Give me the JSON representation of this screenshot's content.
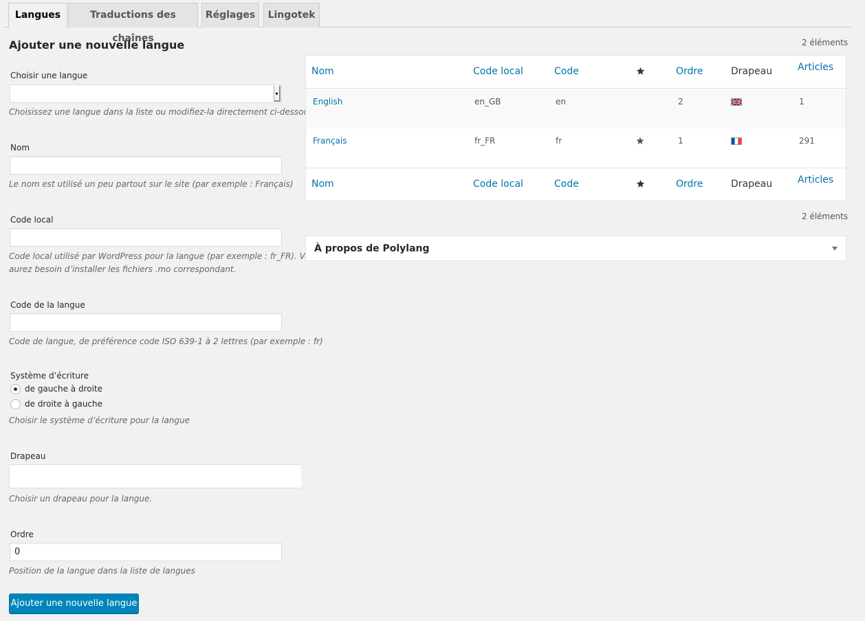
{
  "tabs": [
    "Langues",
    "Traductions des chaînes",
    "Réglages",
    "Lingotek"
  ],
  "form": {
    "title": "Ajouter une nouvelle langue",
    "choose_label": "Choisir une langue",
    "choose_value": "",
    "choose_desc": "Choisissez une langue dans la liste ou modifiez-la directement ci-dessous.",
    "name_label": "Nom",
    "name_value": "",
    "name_desc": "Le nom est utilisé un peu partout sur le site (par exemple : Français)",
    "locale_label": "Code local",
    "locale_value": "",
    "locale_desc_1": "Code local utilisé par WordPress pour la langue (par exemple : fr_FR). Vous",
    "locale_desc_2": "aurez besoin d’installer les fichiers .mo correspondant.",
    "code_label": "Code de la langue",
    "code_value": "",
    "code_desc": "Code de langue, de préférence code ISO 639-1 à 2 lettres (par exemple : fr)",
    "direction_label": "Système d’écriture",
    "direction_ltr": "de gauche à droite",
    "direction_rtl": "de droite à gauche",
    "direction_selected": "ltr",
    "direction_desc": "Choisir le système d’écriture pour la langue",
    "flag_label": "Drapeau",
    "flag_desc": "Choisir un drapeau pour la langue.",
    "order_label": "Ordre",
    "order_value": "0",
    "order_desc": "Position de la langue dans la liste de langues",
    "submit_label": "Ajouter une nouvelle langue"
  },
  "table": {
    "count_top": "2 éléments",
    "count_bottom": "2 éléments",
    "headers": {
      "name": "Nom",
      "locale": "Code local",
      "code": "Code",
      "default_icon": "star-icon",
      "order": "Ordre",
      "flag": "Drapeau",
      "posts": "Articles"
    },
    "rows": [
      {
        "name": "English",
        "locale": "en_GB",
        "code": "en",
        "is_default": false,
        "order": "2",
        "flag": "gb-flag-icon",
        "posts": "1"
      },
      {
        "name": "Français",
        "locale": "fr_FR",
        "code": "fr",
        "is_default": true,
        "order": "1",
        "flag": "fr-flag-icon",
        "posts": "291"
      }
    ]
  },
  "about_box": {
    "title": "À propos de Polylang",
    "icon": "chevron-down-icon"
  },
  "colors": {
    "link": "#0073aa",
    "primary_button": "#0085ba",
    "background": "#f1f1f1"
  }
}
